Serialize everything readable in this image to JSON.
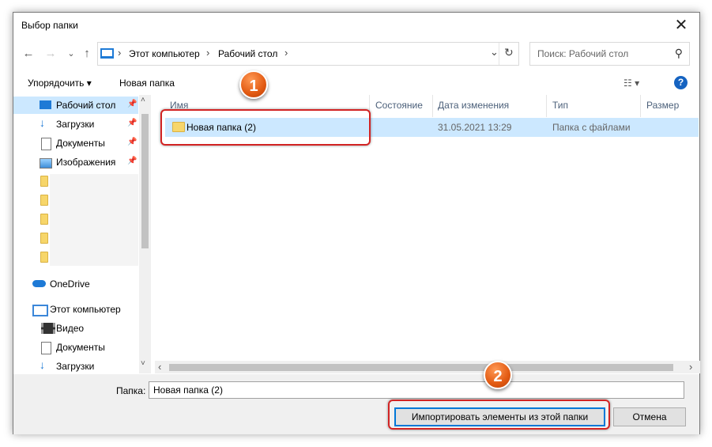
{
  "window": {
    "title": "Выбор папки",
    "close": "✕"
  },
  "nav": {
    "back": "←",
    "forward": "→",
    "recent": "⌄",
    "up": "↑"
  },
  "address": {
    "crumbs": [
      "Этот компьютер",
      "Рабочий стол"
    ],
    "sep": "›",
    "dropdown": "⌄",
    "refresh": "↻"
  },
  "search": {
    "placeholder": "Поиск: Рабочий стол",
    "icon": "⚲"
  },
  "toolbar": {
    "organize": "Упорядочить ▾",
    "new_folder": "Новая папка",
    "view": "☷ ▾",
    "help": "?"
  },
  "sidebar": {
    "quick": [
      {
        "label": "Рабочий стол",
        "icon": "desktop-icon",
        "pinned": true
      },
      {
        "label": "Загрузки",
        "icon": "download-icon",
        "pinned": true
      },
      {
        "label": "Документы",
        "icon": "document-icon",
        "pinned": true
      },
      {
        "label": "Изображения",
        "icon": "image-icon",
        "pinned": true
      }
    ],
    "onedrive": "OneDrive",
    "thispc": "Этот компьютер",
    "pc_items": [
      "Видео",
      "Документы",
      "Загрузки"
    ],
    "pin_glyph": "📌"
  },
  "columns": {
    "name": "Имя",
    "status": "Состояние",
    "date": "Дата изменения",
    "type": "Тип",
    "size": "Размер"
  },
  "files": [
    {
      "name": "Новая папка (2)",
      "date": "31.05.2021 13:29",
      "type": "Папка с файлами"
    }
  ],
  "footer": {
    "folder_label": "Папка:",
    "folder_value": "Новая папка (2)",
    "import_button": "Импортировать элементы из этой папки",
    "cancel_button": "Отмена"
  },
  "annotations": {
    "marker1": "1",
    "marker2": "2"
  },
  "scroll": {
    "left": "‹",
    "right": "›",
    "up": "˄",
    "down": "˅"
  },
  "colors": {
    "accent": "#1e7ad6",
    "selection": "#cce8ff",
    "highlight": "#d22323",
    "marker": "#e25a12"
  }
}
